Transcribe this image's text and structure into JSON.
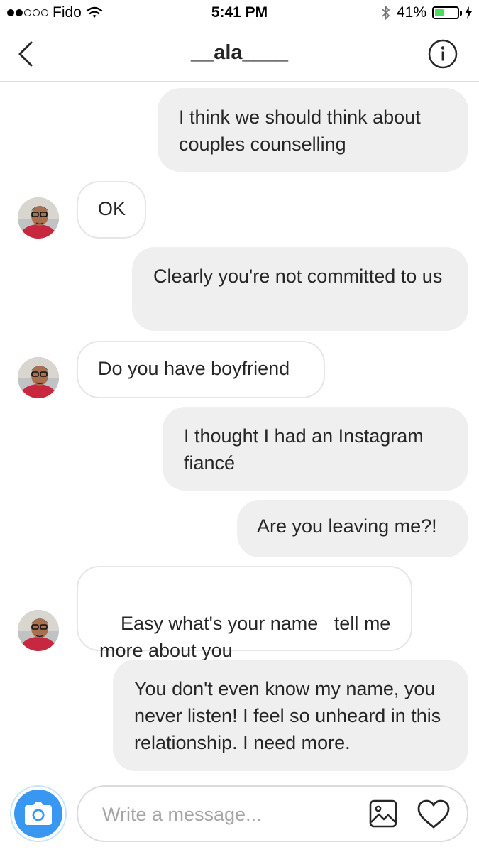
{
  "status_bar": {
    "carrier": "Fido",
    "time": "5:41 PM",
    "battery_percent": "41%",
    "battery_level": 0.41,
    "signal_bars_filled": 2,
    "signal_bars_total": 5
  },
  "header": {
    "title": "__ala____"
  },
  "messages": [
    {
      "direction": "sent",
      "text": "I think we should think about couples counselling"
    },
    {
      "direction": "received",
      "text": "OK"
    },
    {
      "direction": "sent",
      "text": "Clearly you're not committed to us"
    },
    {
      "direction": "received",
      "text": "Do you have boyfriend"
    },
    {
      "direction": "sent",
      "text": "I thought I had an Instagram fiancé"
    },
    {
      "direction": "sent",
      "text": "Are you leaving me?!"
    },
    {
      "direction": "received",
      "text": "Easy what's your name   tell me more about you"
    },
    {
      "direction": "sent",
      "text": "You don't even know my name, you never listen! I feel so unheard in this relationship. I need more."
    }
  ],
  "composer": {
    "placeholder": "Write a message..."
  },
  "icons": {
    "back": "chevron-left-icon",
    "info": "info-icon",
    "camera": "camera-icon",
    "gallery": "image-icon",
    "like": "heart-icon",
    "wifi": "wifi-icon",
    "bluetooth": "bluetooth-icon",
    "charging": "bolt-icon"
  },
  "colors": {
    "accent": "#3897f0",
    "sent_bubble": "#efefef",
    "battery": "#4cd964"
  }
}
